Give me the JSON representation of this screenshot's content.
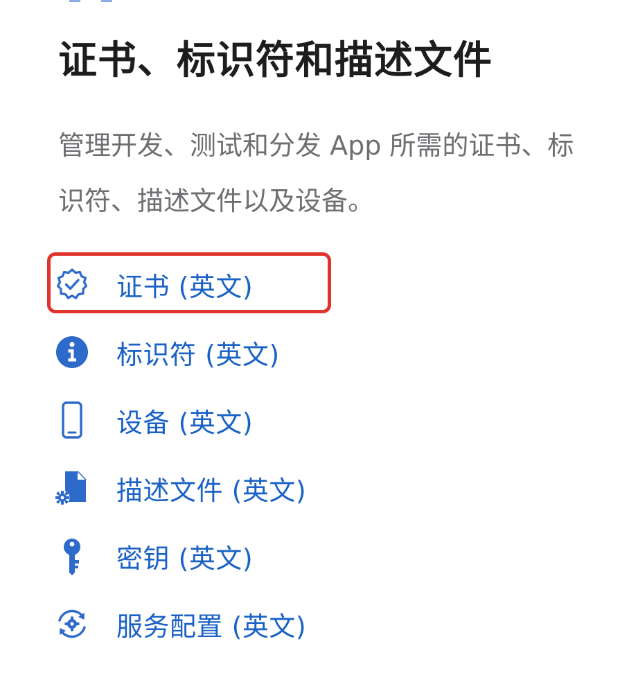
{
  "section": {
    "title": "证书、标识符和描述文件",
    "description_lines": [
      "管理开发、测试和分发 App 所需的证书、标",
      "识符、描述文件以及设备。"
    ]
  },
  "links": [
    {
      "label": "证书 (英文)",
      "icon": "certificate-badge-icon",
      "highlighted": true
    },
    {
      "label": "标识符 (英文)",
      "icon": "info-circle-icon"
    },
    {
      "label": "设备 (英文)",
      "icon": "iphone-device-icon"
    },
    {
      "label": "描述文件 (英文)",
      "icon": "document-gear-icon"
    },
    {
      "label": "密钥 (英文)",
      "icon": "key-icon"
    },
    {
      "label": "服务配置 (英文)",
      "icon": "services-gear-icon"
    }
  ],
  "colors": {
    "link": "#1a62c5",
    "icon": "#2d6ac9",
    "highlight": "#e0332c",
    "title": "#1d1d1f",
    "description": "#6e6e73"
  }
}
